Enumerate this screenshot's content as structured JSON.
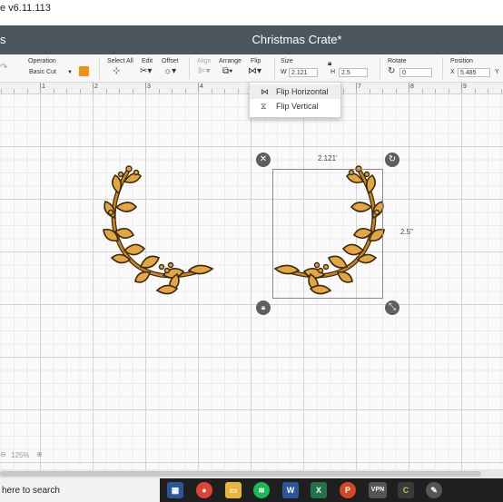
{
  "window": {
    "title_fragment": "e  v6.11.113"
  },
  "appbar": {
    "left_text": "s",
    "project_title": "Christmas Crate*"
  },
  "toolbar": {
    "operation_label": "Operation",
    "operation_value": "Basic Cut",
    "operation_color": "#f29111",
    "select_all_label": "Select All",
    "edit_label": "Edit",
    "offset_label": "Offset",
    "align_label": "Align",
    "arrange_label": "Arrange",
    "flip_label": "Flip",
    "size_label": "Size",
    "width_prefix": "W",
    "width_value": "2.121",
    "height_prefix": "H",
    "height_value": "2.5",
    "rotate_label": "Rotate",
    "rotate_value": "0",
    "position_label": "Position",
    "x_prefix": "X",
    "x_value": "5.485",
    "y_prefix": "Y"
  },
  "ruler": {
    "numbers": [
      "1",
      "2",
      "3",
      "4",
      "5",
      "6",
      "7",
      "8",
      "9"
    ]
  },
  "flip_menu": {
    "items": [
      {
        "label": "Flip Horizontal",
        "icon": "flip-horizontal-icon"
      },
      {
        "label": "Flip Vertical",
        "icon": "flip-vertical-icon"
      }
    ]
  },
  "selection": {
    "width_label": "2.121'",
    "height_label": "2.5\""
  },
  "zoom": {
    "value": "125%"
  },
  "taskbar": {
    "search_text": "here to search",
    "apps": [
      "calendar-icon",
      "chrome-icon",
      "file-explorer-icon",
      "spotify-icon",
      "word-icon",
      "excel-icon",
      "powerpoint-icon",
      "vpn-icon",
      "design-space-icon",
      "inkscape-icon"
    ],
    "vpn_label": "VPN",
    "word_label": "W",
    "excel_label": "X",
    "ppt_label": "P"
  },
  "colors": {
    "header": "#4b565e",
    "wreath_fill": "#c8841e",
    "wreath_stroke": "#3a2a12"
  }
}
